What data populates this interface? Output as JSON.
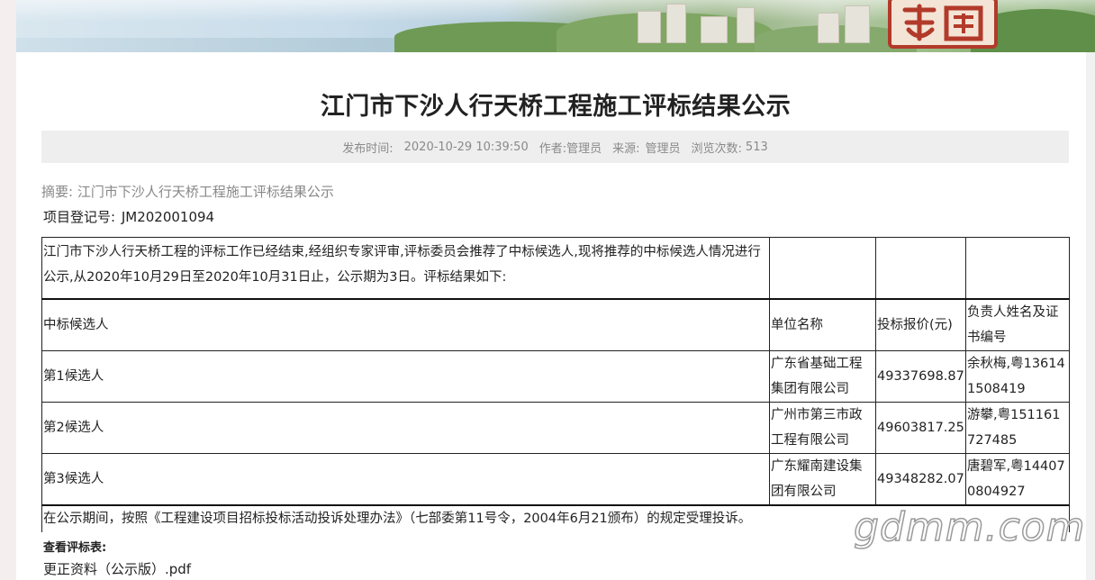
{
  "banner": {
    "seal_text": "都园"
  },
  "article": {
    "title": "江门市下沙人行天桥工程施工评标结果公示",
    "meta": {
      "publish_label": "发布时间:",
      "publish_time": "2020-10-29 10:39:50",
      "author_label": "作者:",
      "author": "管理员",
      "source_label": "来源:",
      "source": "管理员",
      "views_label": "浏览次数:",
      "views": "513"
    },
    "summary": "摘要: 江门市下沙人行天桥工程施工评标结果公示",
    "registration_label": "项目登记号:",
    "registration_no": "JM202001094"
  },
  "table": {
    "intro": "江门市下沙人行天桥工程的评标工作已经结束,经组织专家评审,评标委员会推荐了中标候选人,现将推荐的中标候选人情况进行公示,从2020年10月29日至2020年10月31日止，公示期为3日。评标结果如下:",
    "headers": [
      "中标候选人",
      "单位名称",
      "投标报价(元)",
      "负责人姓名及证书编号"
    ],
    "rows": [
      [
        "第1候选人",
        "广东省基础工程集团有限公司",
        "49337698.87",
        "余秋梅,粤136141508419"
      ],
      [
        "第2候选人",
        "广州市第三市政工程有限公司",
        "49603817.25",
        "游攀,粤151161727485"
      ],
      [
        "第3候选人",
        "广东耀南建设集团有限公司",
        "49348282.07",
        "唐碧军,粤144070804927"
      ]
    ],
    "note": "在公示期间，按照《工程建设项目招标投标活动投诉处理办法》（七部委第11号令，2004年6月21颁布）的规定受理投诉。"
  },
  "attachments": {
    "label": "查看评标表:",
    "file": "更正资料（公示版）.pdf"
  },
  "watermark": "gdmm.com"
}
